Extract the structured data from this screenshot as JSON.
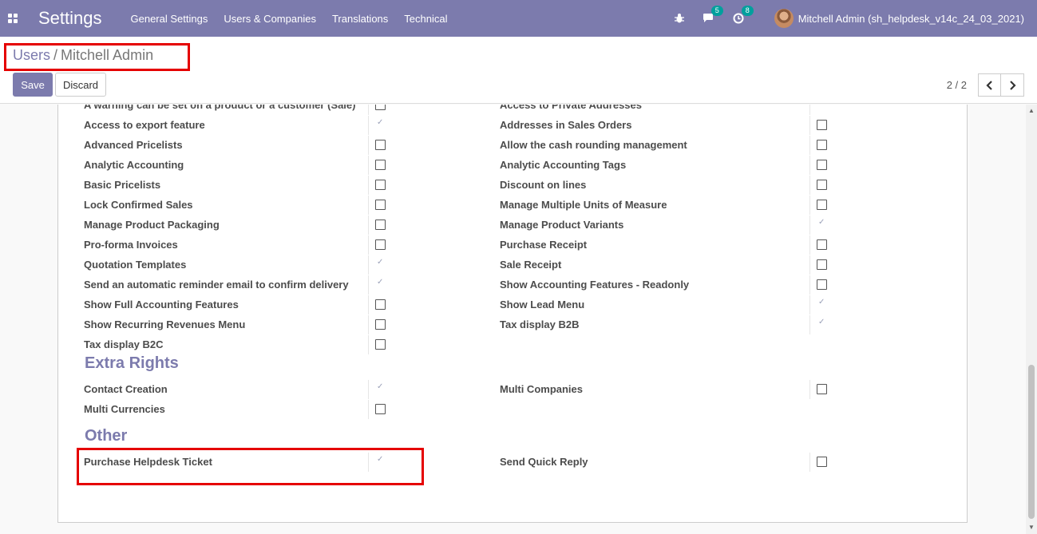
{
  "navbar": {
    "brand": "Settings",
    "menu": [
      "General Settings",
      "Users & Companies",
      "Translations",
      "Technical"
    ],
    "chat_badge": "5",
    "activity_badge": "8",
    "user": "Mitchell Admin (sh_helpdesk_v14c_24_03_2021)"
  },
  "breadcrumb": {
    "parent": "Users",
    "separator": "/",
    "current": "Mitchell Admin"
  },
  "buttons": {
    "save": "Save",
    "discard": "Discard"
  },
  "pager": {
    "value": "2 / 2"
  },
  "technical_rows": [
    {
      "left": "A warning can be set on a product or a customer (Sale)",
      "left_on": false,
      "right": "Access to Private Addresses",
      "right_on": true
    },
    {
      "left": "Access to export feature",
      "left_on": true,
      "right": "Addresses in Sales Orders",
      "right_on": false
    },
    {
      "left": "Advanced Pricelists",
      "left_on": false,
      "right": "Allow the cash rounding management",
      "right_on": false
    },
    {
      "left": "Analytic Accounting",
      "left_on": false,
      "right": "Analytic Accounting Tags",
      "right_on": false
    },
    {
      "left": "Basic Pricelists",
      "left_on": false,
      "right": "Discount on lines",
      "right_on": false
    },
    {
      "left": "Lock Confirmed Sales",
      "left_on": false,
      "right": "Manage Multiple Units of Measure",
      "right_on": false
    },
    {
      "left": "Manage Product Packaging",
      "left_on": false,
      "right": "Manage Product Variants",
      "right_on": true
    },
    {
      "left": "Pro-forma Invoices",
      "left_on": false,
      "right": "Purchase Receipt",
      "right_on": false
    },
    {
      "left": "Quotation Templates",
      "left_on": true,
      "right": "Sale Receipt",
      "right_on": false
    },
    {
      "left": "Send an automatic reminder email to confirm delivery",
      "left_on": true,
      "right": "Show Accounting Features - Readonly",
      "right_on": false
    },
    {
      "left": "Show Full Accounting Features",
      "left_on": false,
      "right": "Show Lead Menu",
      "right_on": true
    },
    {
      "left": "Show Recurring Revenues Menu",
      "left_on": false,
      "right": "Tax display B2B",
      "right_on": true
    },
    {
      "left": "Tax display B2C",
      "left_on": false,
      "right": null,
      "right_on": null
    }
  ],
  "extra_rights": {
    "title": "Extra Rights",
    "rows": [
      {
        "left": "Contact Creation",
        "left_on": true,
        "right": "Multi Companies",
        "right_on": false
      },
      {
        "left": "Multi Currencies",
        "left_on": false,
        "right": null,
        "right_on": null
      }
    ]
  },
  "other": {
    "title": "Other",
    "rows": [
      {
        "left": "Purchase Helpdesk Ticket",
        "left_on": true,
        "right": "Send Quick Reply",
        "right_on": false
      }
    ]
  },
  "colors": {
    "primary": "#7c7bad",
    "highlight": "#e50000"
  }
}
